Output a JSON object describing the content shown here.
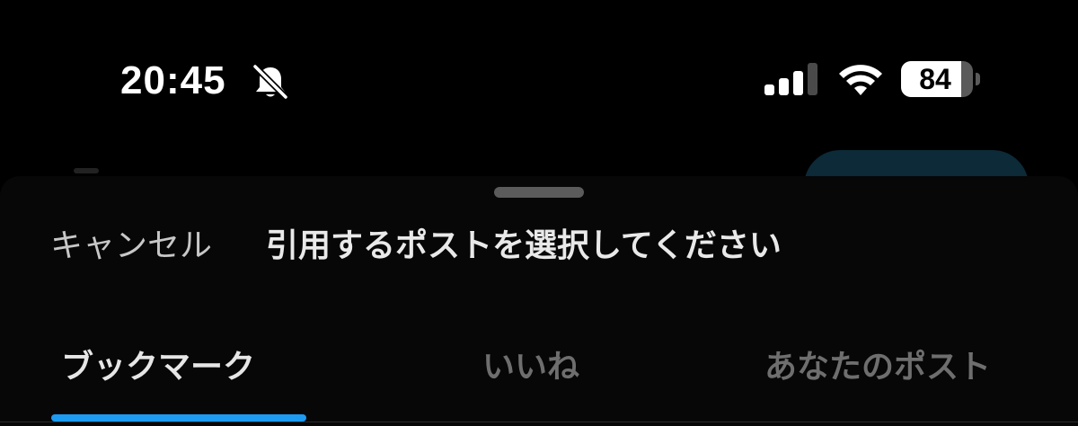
{
  "status_bar": {
    "time": "20:45",
    "silent_icon": "bell-slash-icon",
    "signal_icon": "cellular-signal-icon",
    "signal_bars": 4,
    "signal_bars_active": 3,
    "wifi_icon": "wifi-icon",
    "battery_icon": "battery-icon",
    "battery_level": "84"
  },
  "sheet": {
    "cancel_label": "キャンセル",
    "title": "引用するポストを選択してください"
  },
  "tabs": [
    {
      "label": "ブックマーク",
      "active": true
    },
    {
      "label": "いいね",
      "active": false
    },
    {
      "label": "あなたのポスト",
      "active": false
    }
  ],
  "colors": {
    "background": "#000000",
    "accent": "#1d9bf0",
    "tab_active": "#e6e6e6",
    "tab_inactive": "#6e6e6e"
  }
}
